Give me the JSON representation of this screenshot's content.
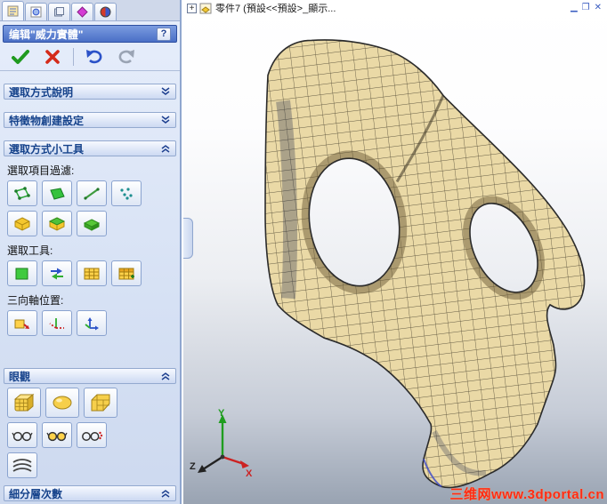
{
  "colors": {
    "mesh_fill": "#ead9a6",
    "mesh_line": "#4e4632",
    "panel_accent": "#4a6fc6",
    "section_text": "#15428b",
    "watermark_red": "#ff2b15",
    "axis_x": "#cc2222",
    "axis_y": "#1f9d1f",
    "axis_z": "#222222"
  },
  "panel": {
    "tabs": [
      {
        "name": "property-manager-tab",
        "icon": "document-lines-icon"
      },
      {
        "name": "configuration-tab",
        "icon": "sphere-badge-icon"
      },
      {
        "name": "display-manager-tab",
        "icon": "stacked-layers-icon"
      },
      {
        "name": "dimxpert-tab",
        "icon": "magenta-diamond-icon"
      },
      {
        "name": "appearance-tab",
        "icon": "red-blue-orb-icon"
      }
    ],
    "header": {
      "title": "编辑\"威力實體\"",
      "help": "?"
    },
    "toolbar": {
      "buttons": [
        {
          "name": "ok",
          "icon": "green-check-icon"
        },
        {
          "name": "cancel",
          "icon": "red-x-icon"
        },
        {
          "name": "undo",
          "icon": "undo-arrow-icon"
        },
        {
          "name": "redo",
          "icon": "redo-arrow-icon"
        }
      ]
    },
    "sections": {
      "selection_help": {
        "label": "選取方式說明",
        "expanded": false
      },
      "feature_create": {
        "label": "特徵物創建設定",
        "expanded": false
      },
      "selection_tools": {
        "label": "選取方式小工具",
        "expanded": true,
        "groups": {
          "filter": {
            "label": "選取項目過濾:",
            "icons": [
              "filter-vertices",
              "filter-faces",
              "filter-edges",
              "filter-points",
              "filter-body",
              "filter-body-face",
              "filter-body-flat"
            ]
          },
          "tools": {
            "label": "選取工具:",
            "icons": [
              "select-faces",
              "swap-selection",
              "select-grid",
              "select-table"
            ]
          },
          "triad": {
            "label": "三向軸位置:",
            "icons": [
              "triad-default",
              "triad-move",
              "triad-align"
            ]
          }
        }
      },
      "view": {
        "label": "眼觀",
        "expanded": true,
        "icons": [
          "display-cage-box",
          "display-smooth",
          "display-cage-cut",
          "glasses-wireframe",
          "glasses-shaded",
          "glasses-points",
          "isoparm-layers"
        ]
      },
      "subdivision": {
        "label": "細分層次數"
      }
    }
  },
  "viewport": {
    "doc_title": "零件7 (預設<<預設>_顯示...",
    "window_controls": [
      "minimize",
      "restore",
      "close"
    ],
    "watermark": "三维网www.3dportal.cn",
    "triad": {
      "x": "X",
      "y": "Y",
      "z": "Z"
    },
    "model": "subdivision-surface-mask"
  }
}
